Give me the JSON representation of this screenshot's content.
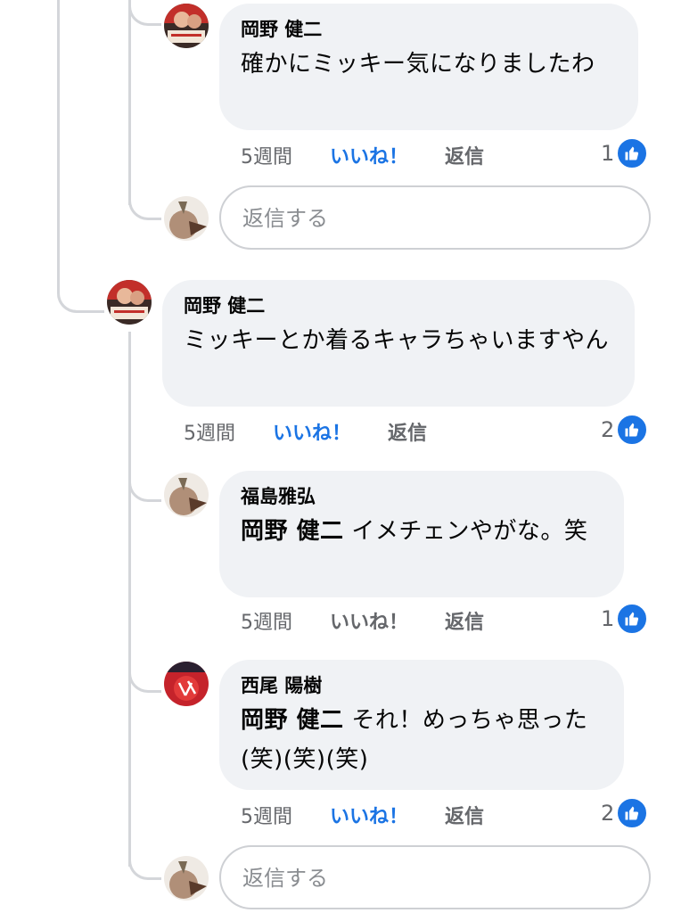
{
  "comments": [
    {
      "author": "岡野 健二",
      "text": "確かにミッキー気になりましたわ",
      "time": "5週間",
      "like_label": "いいね！",
      "reply_label": "返信",
      "like_count": "1",
      "liked": true
    },
    {
      "author": "岡野 健二",
      "text": "ミッキーとか着るキャラちゃいますやん",
      "time": "5週間",
      "like_label": "いいね！",
      "reply_label": "返信",
      "like_count": "2",
      "liked": true
    },
    {
      "author": "福島雅弘",
      "mention": "岡野 健二",
      "text": " イメチェンやがな。笑",
      "time": "5週間",
      "like_label": "いいね！",
      "reply_label": "返信",
      "like_count": "1",
      "liked": false
    },
    {
      "author": "西尾 陽樹",
      "mention": "岡野 健二",
      "text": " それ！めっちゃ思った(笑)(笑)(笑)",
      "time": "5週間",
      "like_label": "いいね！",
      "reply_label": "返信",
      "like_count": "2",
      "liked": true
    }
  ],
  "reply_inputs": [
    {
      "placeholder": "返信する"
    },
    {
      "placeholder": "返信する"
    }
  ],
  "colors": {
    "like_blue": "#1b74e4",
    "bubble_gray": "#f0f2f5",
    "meta_gray": "#65676b",
    "thread_line": "#d4d6da"
  },
  "icons": {
    "like_badge": "thumbs-up-icon"
  }
}
